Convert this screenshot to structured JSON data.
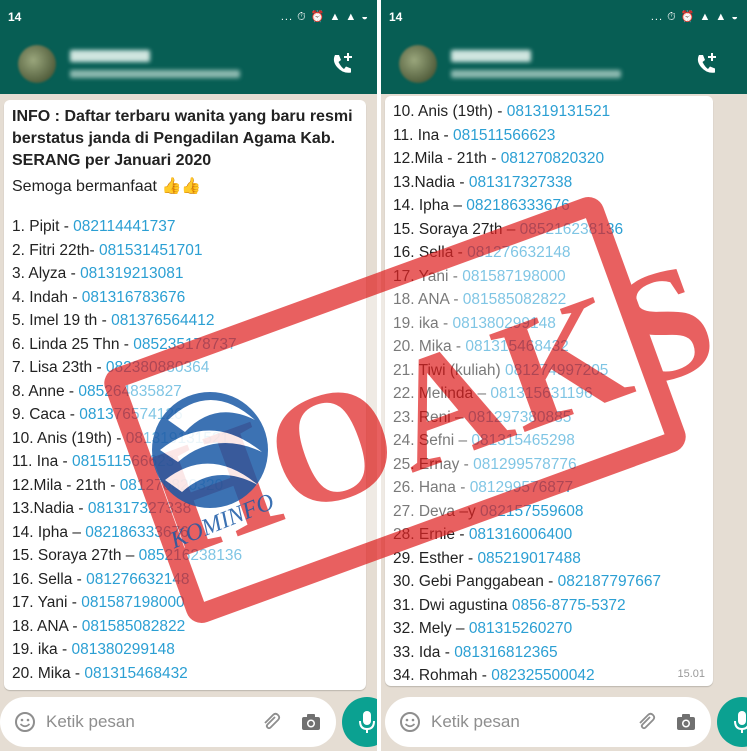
{
  "left": {
    "status_time": "14",
    "status_icons": "... ⏱ ⏰ ▲ ▲ ◒",
    "message": {
      "info": "INFO : Daftar terbaru wanita yang baru resmi berstatus janda di Pengadilan Agama Kab. SERANG per Januari 2020",
      "greeting": "Semoga bermanfaat",
      "thumbs": "👍👍",
      "entries": [
        {
          "label": "1. Pipit - ",
          "phone": "082114441737"
        },
        {
          "label": "2. Fitri 22th- ",
          "phone": "081531451701"
        },
        {
          "label": "3. Alyza - ",
          "phone": "081319213081"
        },
        {
          "label": "4. Indah - ",
          "phone": "081316783676"
        },
        {
          "label": "5. Imel 19 th - ",
          "phone": "081376564412"
        },
        {
          "label": "6. Linda 25 Thn - ",
          "phone": "085235178737"
        },
        {
          "label": "7. Lisa 23th - ",
          "phone": "082380880364"
        },
        {
          "label": "8. Anne - ",
          "phone": "085264835827"
        },
        {
          "label": "9. Caca - ",
          "phone": "081376574126"
        },
        {
          "label": "10. Anis (19th) - ",
          "phone": "081319131521"
        },
        {
          "label": "11. Ina - ",
          "phone": "081511566623"
        },
        {
          "label": "12.Mila - 21th - ",
          "phone": "081270820320"
        },
        {
          "label": "13.Nadia - ",
          "phone": "081317327338"
        },
        {
          "label": "14. Ipha – ",
          "phone": "082186333676"
        },
        {
          "label": "15. Soraya 27th – ",
          "phone": "085216238136"
        },
        {
          "label": "16. Sella - ",
          "phone": "081276632148"
        },
        {
          "label": "17. Yani - ",
          "phone": "081587198000"
        },
        {
          "label": "18. ANA - ",
          "phone": "081585082822"
        },
        {
          "label": "19. ika - ",
          "phone": "081380299148"
        },
        {
          "label": "20. Mika - ",
          "phone": "081315468432"
        }
      ]
    },
    "input_placeholder": "Ketik pesan"
  },
  "right": {
    "status_time": "14",
    "status_icons": "... ⏱ ⏰ ▲ ▲ ◒",
    "message": {
      "entries": [
        {
          "label": "10. Anis (19th) - ",
          "phone": "081319131521"
        },
        {
          "label": "11. Ina - ",
          "phone": "081511566623"
        },
        {
          "label": "12.Mila - 21th - ",
          "phone": "081270820320"
        },
        {
          "label": "13.Nadia - ",
          "phone": "081317327338"
        },
        {
          "label": "14. Ipha – ",
          "phone": "082186333676"
        },
        {
          "label": "15. Soraya 27th – ",
          "phone": "085216238136"
        },
        {
          "label": "16. Sella - ",
          "phone": "081276632148"
        },
        {
          "label": "17. Yani - ",
          "phone": "081587198000"
        },
        {
          "label": "18. ANA - ",
          "phone": "081585082822"
        },
        {
          "label": "19. ika - ",
          "phone": "081380299148"
        },
        {
          "label": "20. Mika - ",
          "phone": "081315468432"
        },
        {
          "label": "21. Tiwi (kuliah) ",
          "phone": "081274997205"
        },
        {
          "label": "22. Melinda – ",
          "phone": "081315631196"
        },
        {
          "label": "23. Reni – ",
          "phone": "081297380885"
        },
        {
          "label": "24. Sefni – ",
          "phone": "081315465298"
        },
        {
          "label": "25. Ernay - ",
          "phone": "081299578776"
        },
        {
          "label": "26. Hana - ",
          "phone": "081299576877"
        },
        {
          "label": "27. Deva –y ",
          "phone": "082157559608"
        },
        {
          "label": "28. Ernie - ",
          "phone": "081316006400"
        },
        {
          "label": "29. Esther - ",
          "phone": "085219017488"
        },
        {
          "label": "30. Gebi Panggabean - ",
          "phone": "082187797667"
        },
        {
          "label": "31. Dwi agustina ",
          "phone": "0856-8775-5372"
        },
        {
          "label": "32. Mely – ",
          "phone": "081315260270"
        },
        {
          "label": "33. Ida - ",
          "phone": "081316812365"
        },
        {
          "label": "34. Rohmah - ",
          "phone": "082325500042"
        }
      ],
      "time": "15.01"
    },
    "input_placeholder": "Ketik pesan"
  },
  "stamp": {
    "word": "HOAKS",
    "logo_text": "KOMINFO",
    "stamp_color": "#e02424",
    "logo_color": "#1b5aa6"
  }
}
